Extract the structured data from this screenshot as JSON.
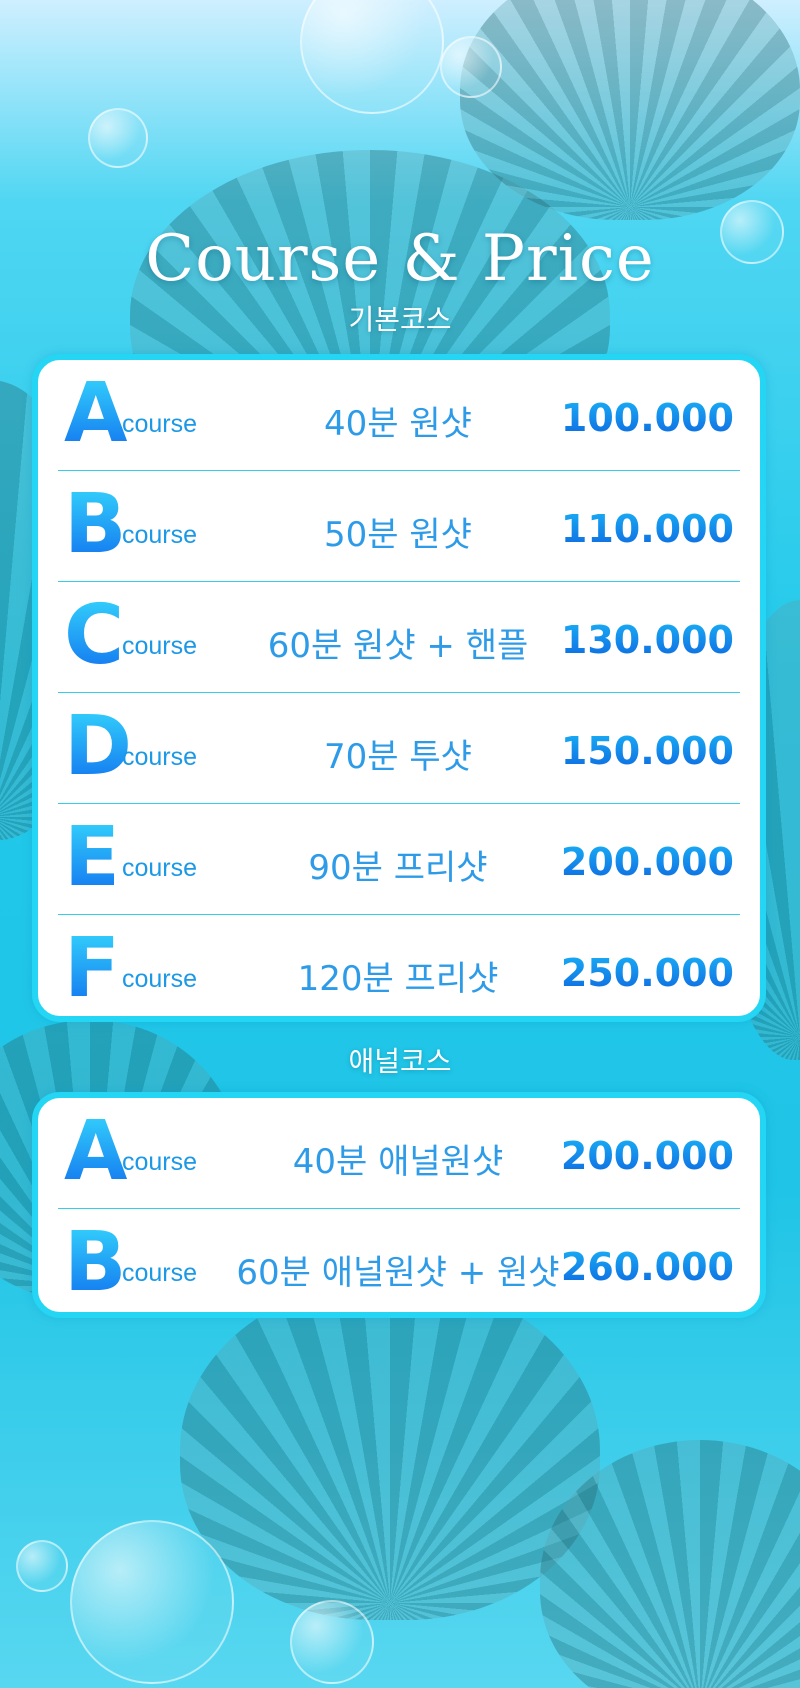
{
  "header": {
    "title": "Course & Price",
    "basic_heading": "기본코스",
    "anal_heading": "애널코스"
  },
  "basic_courses": [
    {
      "letter": "A",
      "course": "course",
      "desc": "40분 원샷",
      "price": "100.000"
    },
    {
      "letter": "B",
      "course": "course",
      "desc": "50분 원샷",
      "price": "110.000"
    },
    {
      "letter": "C",
      "course": "course",
      "desc": "60분 원샷 + 핸플",
      "price": "130.000"
    },
    {
      "letter": "D",
      "course": "course",
      "desc": "70분 투샷",
      "price": "150.000"
    },
    {
      "letter": "E",
      "course": "course",
      "desc": "90분 프리샷",
      "price": "200.000"
    },
    {
      "letter": "F",
      "course": "course",
      "desc": "120분 프리샷",
      "price": "250.000"
    }
  ],
  "anal_courses": [
    {
      "letter": "A",
      "course": "course",
      "desc": "40분 애널원샷",
      "price": "200.000"
    },
    {
      "letter": "B",
      "course": "course",
      "desc": "60분 애널원샷 + 원샷",
      "price": "260.000"
    }
  ]
}
